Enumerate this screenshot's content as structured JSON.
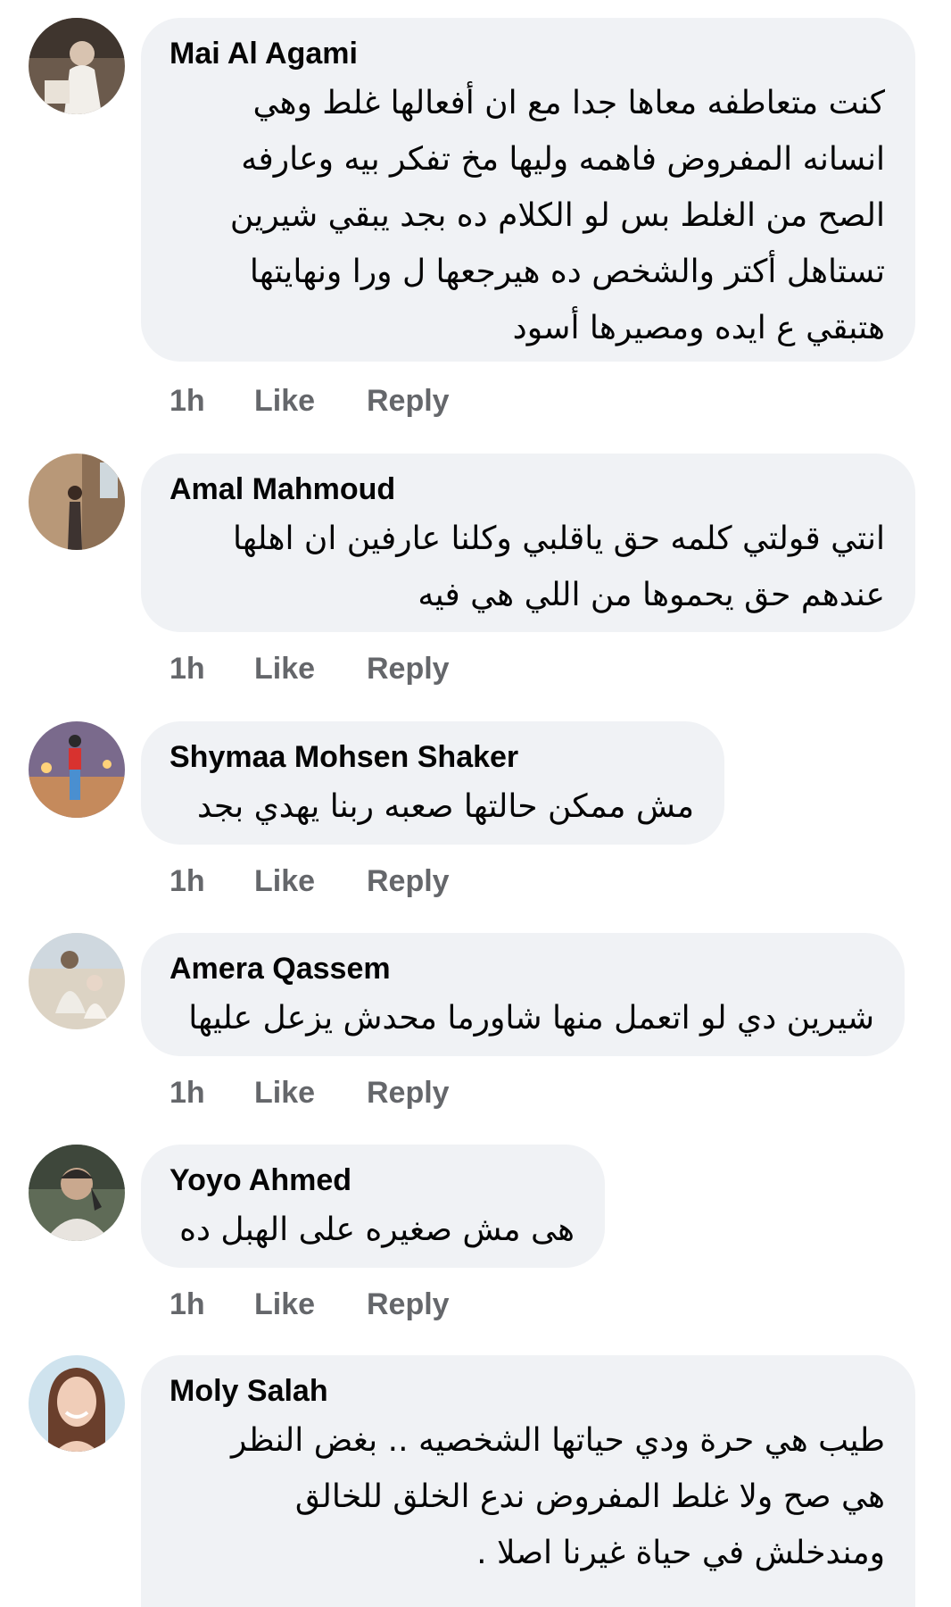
{
  "comments": [
    {
      "author": "Mai Al Agami",
      "lines": [
        "كنت متعاطفه معاها جدا مع ان أفعالها غلط وهي",
        "انسانه المفروض فاهمه وليها مخ تفكر بيه وعارفه",
        "الصح من الغلط بس لو الكلام ده بجد يبقي شيرين",
        "تستاهل أكتر والشخص ده هيرجعها ل ورا ونهايتها",
        "هتبقي ع ايده ومصيرها أسود"
      ],
      "time": "1h",
      "like": "Like",
      "reply": "Reply"
    },
    {
      "author": "Amal Mahmoud",
      "lines": [
        "انتي قولتي كلمه حق ياقلبي وكلنا عارفين ان اهلها",
        "عندهم حق يحموها من اللي هي فيه"
      ],
      "time": "1h",
      "like": "Like",
      "reply": "Reply"
    },
    {
      "author": "Shymaa Mohsen Shaker",
      "lines": [
        "مش ممكن حالتها صعبه ربنا يهدي بجد"
      ],
      "time": "1h",
      "like": "Like",
      "reply": "Reply"
    },
    {
      "author": "Amera Qassem",
      "lines": [
        "شيرين دي لو اتعمل منها شاورما محدش يزعل عليها"
      ],
      "time": "1h",
      "like": "Like",
      "reply": "Reply"
    },
    {
      "author": "Yoyo Ahmed",
      "lines": [
        "هى مش صغيره على الهبل ده"
      ],
      "time": "1h",
      "like": "Like",
      "reply": "Reply"
    },
    {
      "author": "Moly Salah",
      "lines": [
        "طيب هي حرة ودي حياتها الشخصيه .. بغض النظر",
        "هي صح ولا غلط  المفروض ندع الخلق للخالق",
        "ومندخلش في حياة غيرنا اصلا ."
      ]
    }
  ],
  "colors": {
    "bubble": "#f0f2f5",
    "author": "#050505",
    "meta": "#65676b"
  }
}
